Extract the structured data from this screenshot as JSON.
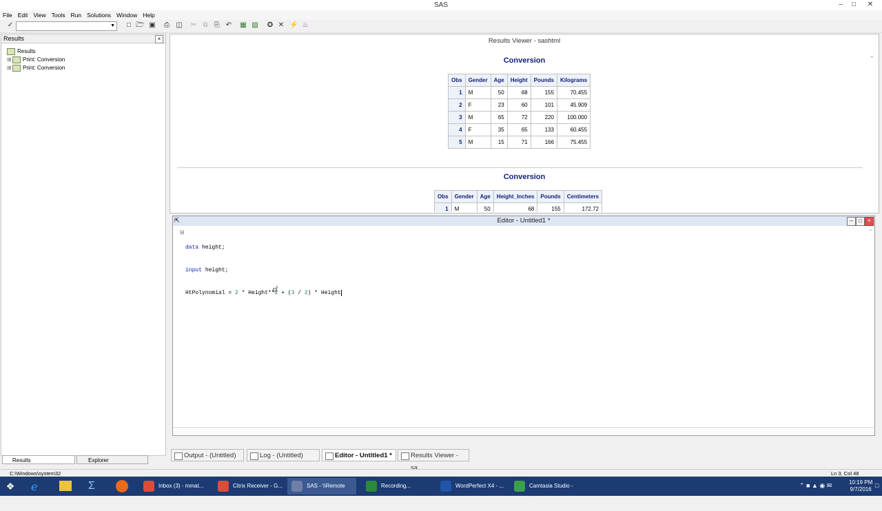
{
  "window": {
    "title": "SAS"
  },
  "menu": [
    "File",
    "Edit",
    "View",
    "Tools",
    "Run",
    "Solutions",
    "Window",
    "Help"
  ],
  "results_pane": {
    "title": "Results",
    "tree": [
      {
        "label": "Results",
        "level": 0
      },
      {
        "label": "Print: Conversion",
        "level": 1
      },
      {
        "label": "Print: Conversion",
        "level": 1
      }
    ]
  },
  "results_viewer": {
    "title": "Results Viewer - sashtml",
    "table1": {
      "title": "Conversion",
      "headers": [
        "Obs",
        "Gender",
        "Age",
        "Height",
        "Pounds",
        "Kilograms"
      ],
      "rows": [
        [
          "1",
          "M",
          "50",
          "68",
          "155",
          "70.455"
        ],
        [
          "2",
          "F",
          "23",
          "60",
          "101",
          "45.909"
        ],
        [
          "3",
          "M",
          "65",
          "72",
          "220",
          "100.000"
        ],
        [
          "4",
          "F",
          "35",
          "65",
          "133",
          "60.455"
        ],
        [
          "5",
          "M",
          "15",
          "71",
          "166",
          "75.455"
        ]
      ]
    },
    "table2": {
      "title": "Conversion",
      "headers": [
        "Obs",
        "Gender",
        "Age",
        "Height_Inches",
        "Pounds",
        "Centimeters"
      ],
      "rows": [
        [
          "1",
          "M",
          "50",
          "68",
          "155",
          "172.72"
        ]
      ]
    }
  },
  "editor": {
    "title": "Editor - Untitled1 *",
    "lines": [
      "data height;",
      "input height;",
      "HtPolynomial = 2 * Height**2 + (3 / 2) * Height"
    ],
    "code": {
      "l1_kw": "data",
      "l1_rest": " height;",
      "l2_kw": "input",
      "l2_rest": " height;",
      "l3_a": "HtPolynomial = ",
      "l3_n1": "2",
      "l3_b": " * Height**",
      "l3_n2": "2",
      "l3_c": " + (",
      "l3_n3": "3",
      "l3_d": " / ",
      "l3_n4": "2",
      "l3_e": ") * Height"
    }
  },
  "window_tabs": [
    {
      "label": "Output - (Untitled)",
      "active": false
    },
    {
      "label": "Log - (Untitled)",
      "active": false
    },
    {
      "label": "Editor - Untitled1 *",
      "active": true
    },
    {
      "label": "Results Viewer - sa...",
      "active": false
    }
  ],
  "pane_tabs": [
    "Results",
    "Explorer"
  ],
  "status": {
    "path": "C:\\Windows\\system32",
    "position": "Ln 3, Col 48"
  },
  "taskbar": {
    "apps": [
      {
        "label": "Inbox (3) - mmat...",
        "color": "#dd4b39"
      },
      {
        "label": "Citrix Receiver - G...",
        "color": "#dd4b39"
      },
      {
        "label": "SAS - \\\\Remote",
        "color": "#6e7fa8"
      },
      {
        "label": "Recording...",
        "color": "#2a8a3a"
      },
      {
        "label": "WordPerfect X4 - ...",
        "color": "#2255aa"
      },
      {
        "label": "Camtasia Studio - ...",
        "color": "#3aa04a"
      }
    ],
    "time": "10:19 PM",
    "date": "9/7/2016"
  }
}
